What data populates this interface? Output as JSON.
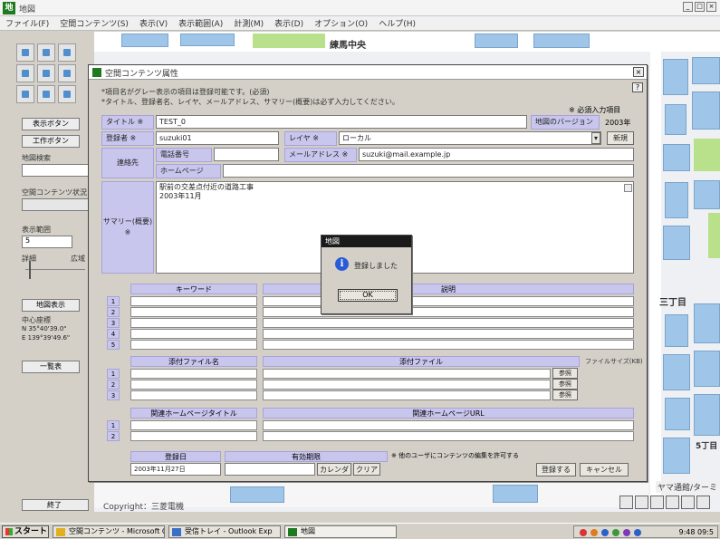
{
  "app": {
    "title": "地図",
    "menu": [
      "ファイル(F)",
      "空間コンテンツ(S)",
      "表示(V)",
      "表示範囲(A)",
      "計測(M)",
      "表示(D)",
      "オプション(O)",
      "ヘルプ(H)"
    ]
  },
  "left_panel": {
    "btn1": "表示ボタン",
    "btn2": "工作ボタン",
    "label1": "地図検索",
    "label2": "空間コンテンツ状況",
    "label3": "表示範囲",
    "select_value": "5",
    "zoom_min": "詳細",
    "zoom_max": "広域",
    "btn3": "地図表示",
    "coord_label": "中心座標",
    "coord_n": "N 35°40'39.0\"",
    "coord_e": "E 139°39'49.6\"",
    "btn4": "一覧表",
    "bottom_btn": "終了"
  },
  "map": {
    "label_top": "練馬中央",
    "label_right1": "三丁目",
    "label_right2": "5丁目",
    "corner_label": "ヤマ通館/ターミ",
    "copyright": "Copyright：三菱電機"
  },
  "dialog": {
    "title": "空間コンテンツ属性",
    "note1": "*項目名がグレー表示の項目は登録可能です。(必須)",
    "note2": "*タイトル、登録者名、レイヤ、メールアドレス、サマリー(概要)は必ず入力してください。",
    "required_note": "※ 必須入力項目",
    "title_label": "タイトル ※",
    "title_value": "TEST_0",
    "version_label": "地図のバージョン",
    "version_value": "2003年",
    "registrant_label": "登録者 ※",
    "registrant_value": "suzuki01",
    "layer_label": "レイヤ ※",
    "layer_value": "ローカル",
    "add_btn": "新規",
    "contact_label": "連絡先",
    "phone_label": "電話番号",
    "phone_value": "",
    "email_label": "メールアドレス ※",
    "email_value": "suzuki@mail.example.jp",
    "homepage_label": "ホームページ",
    "homepage_value": "",
    "summary_label": "サマリー(概要) ※",
    "summary_line1": "駅前の交差点付近の道路工事",
    "summary_line2": "2003年11月",
    "keyword_col": "キーワード",
    "explain_col": "説明",
    "rows": [
      "1",
      "2",
      "3",
      "4",
      "5"
    ],
    "attach_name_col": "添付ファイル名",
    "attach_path_col": "添付ファイル",
    "attach_size_label": "ファイルサイズ(KB)",
    "attach_rows": [
      "1",
      "2",
      "3"
    ],
    "ref_btn": "参照",
    "related_title_col": "関連ホームページタイトル",
    "related_url_col": "関連ホームページURL",
    "related_rows": [
      "1",
      "2"
    ],
    "reg_date_label": "登録日",
    "reg_date_value": "2003年11月27日",
    "valid_label": "有効期限",
    "calendar_btn": "カレンダ",
    "clear_btn": "クリア",
    "footer_note": "※ 他のユーザにコンテンツの編集を許可する",
    "register_btn": "登録する",
    "cancel_btn": "キャンセル"
  },
  "msgbox": {
    "title": "地図",
    "message": "登録しました",
    "ok": "OK"
  },
  "taskbar": {
    "start": "スタート",
    "items": [
      "空間コンテンツ - Microsoft Ou",
      "受信トレイ - Outlook Exp",
      "地図"
    ],
    "clock": "9:48 09:5"
  }
}
